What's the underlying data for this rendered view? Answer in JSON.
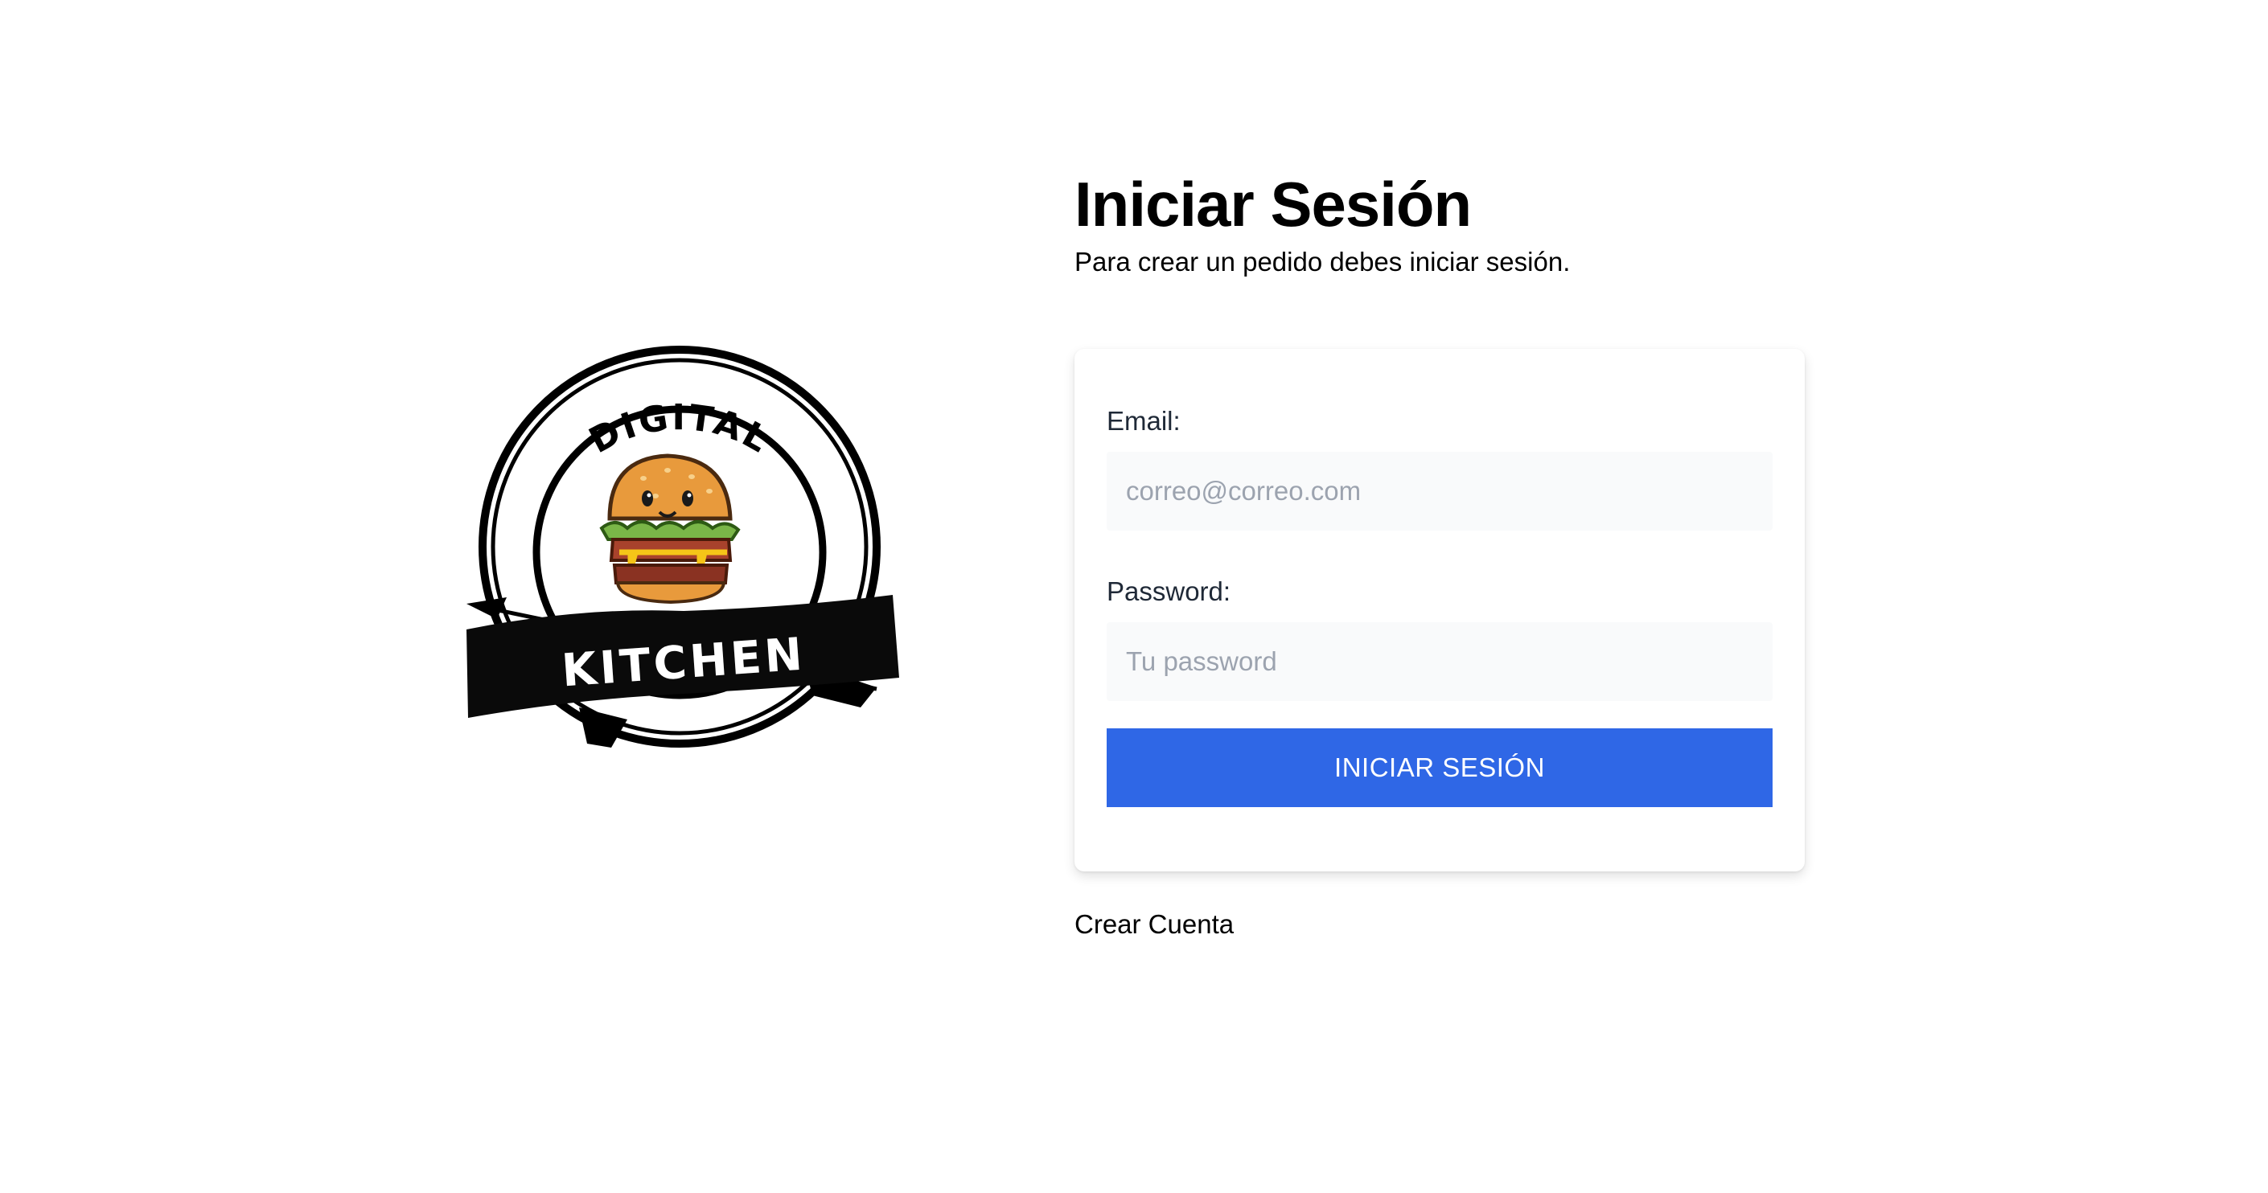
{
  "logo": {
    "brand_top": "DIGITAL",
    "brand_bottom": "KITCHEN",
    "icon": "burger-mascot-icon"
  },
  "header": {
    "title": "Iniciar Sesión",
    "subtitle": "Para crear un pedido debes iniciar sesión."
  },
  "form": {
    "email_label": "Email:",
    "email_placeholder": "correo@correo.com",
    "email_value": "",
    "password_label": "Password:",
    "password_placeholder": "Tu password",
    "password_value": "",
    "submit_label": "INICIAR SESIÓN"
  },
  "links": {
    "create_account": "Crear Cuenta"
  },
  "colors": {
    "primary_button": "#2f67e6",
    "input_background": "#f9fafb"
  }
}
